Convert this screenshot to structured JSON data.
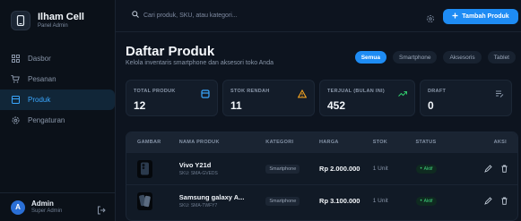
{
  "brand": {
    "title": "Ilham Cell",
    "subtitle": "Panel Admin"
  },
  "sidebar": {
    "items": [
      {
        "label": "Dasbor",
        "icon": "grid-icon"
      },
      {
        "label": "Pesanan",
        "icon": "cart-icon"
      },
      {
        "label": "Produk",
        "icon": "box-icon",
        "active": true
      },
      {
        "label": "Pengaturan",
        "icon": "gear-icon"
      }
    ]
  },
  "user": {
    "initial": "A",
    "name": "Admin",
    "role": "Super Admin"
  },
  "search": {
    "placeholder": "Cari produk, SKU, atau kategori..."
  },
  "topbar": {
    "add_label": "Tambah Produk"
  },
  "page": {
    "title": "Daftar Produk",
    "subtitle": "Kelola inventaris smartphone dan aksesori toko Anda"
  },
  "filters": [
    "Semua",
    "Smartphone",
    "Aksesoris",
    "Tablet"
  ],
  "stats": [
    {
      "label": "TOTAL PRODUK",
      "value": "12",
      "color": "#3aa7ff"
    },
    {
      "label": "STOK RENDAH",
      "value": "11",
      "color": "#f0a020"
    },
    {
      "label": "TERJUAL (BULAN INI)",
      "value": "452",
      "color": "#2fc46a"
    },
    {
      "label": "DRAFT",
      "value": "0",
      "color": "#8a97aa"
    }
  ],
  "table": {
    "headers": [
      "GAMBAR",
      "NAMA PRODUK",
      "KATEGORI",
      "HARGA",
      "STOK",
      "STATUS",
      "AKSI"
    ],
    "rows": [
      {
        "name": "Vivo Y21d",
        "sku": "SKU: SMA-GVEDS",
        "category": "Smartphone",
        "price": "Rp 2.000.000",
        "stock": "1 Unit",
        "status": "Aktif"
      },
      {
        "name": "Samsung galaxy A...",
        "sku": "SKU: SMA-TWFY7",
        "category": "Smartphone",
        "price": "Rp 3.100.000",
        "stock": "1 Unit",
        "status": "Aktif"
      }
    ]
  },
  "colors": {
    "accent": "#1e8cf4",
    "active_status": "#3fd07a"
  }
}
